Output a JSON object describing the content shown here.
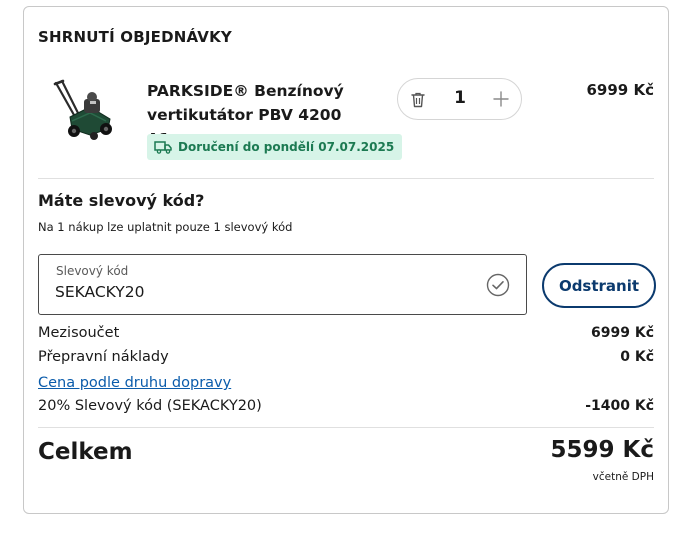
{
  "summary": {
    "title": "SHRNUTÍ OBJEDNÁVKY"
  },
  "product": {
    "name": "PARKSIDE® Benzínový vertikutátor PBV 4200 A1",
    "image_icon": "scarifier-product-image",
    "delivery": "Doručení do pondělí 07.07.2025",
    "delivery_icon": "truck-icon",
    "quantity": "1",
    "price": "6999 Kč"
  },
  "coupon": {
    "heading": "Máte slevový kód?",
    "note": "Na 1 nákup lze uplatnit pouze 1 slevový kód",
    "field_label": "Slevový kód",
    "value": "SEKACKY20",
    "remove_label": "Odstranit"
  },
  "totals": {
    "subtotal_label": "Mezisoučet",
    "subtotal_value": "6999 Kč",
    "shipping_label": "Přepravní náklady",
    "shipping_value": "0 Kč",
    "shipping_link": "Cena podle druhu dopravy",
    "discount_label": "20% Slevový kód (SEKACKY20)",
    "discount_value": "-1400 Kč",
    "total_label": "Celkem",
    "total_value": "5599 Kč",
    "vat_note": "včetně DPH"
  },
  "colors": {
    "accent": "#0b3a6e",
    "link": "#0b5cab",
    "delivery_bg": "#d7f4e8",
    "delivery_text": "#1c7a52",
    "border": "#c8c8c8"
  }
}
